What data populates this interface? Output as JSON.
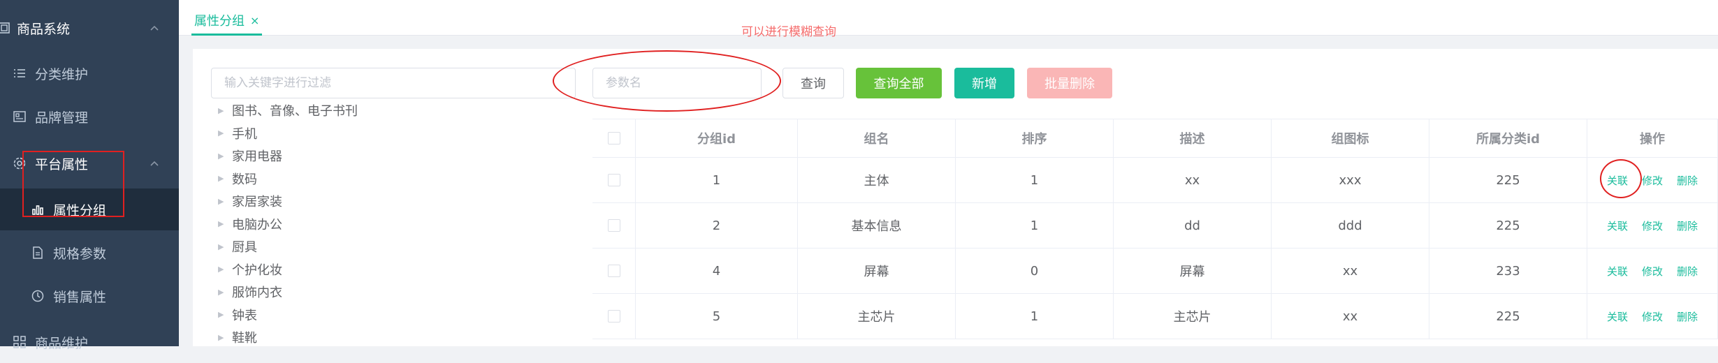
{
  "sidebar": {
    "items": [
      {
        "label": "商品系统",
        "icon": "grid-icon",
        "chevron": "^"
      },
      {
        "label": "分类维护",
        "icon": "list-icon"
      },
      {
        "label": "品牌管理",
        "icon": "picture-icon"
      },
      {
        "label": "平台属性",
        "icon": "gear-icon",
        "chevron": "^"
      },
      {
        "label": "属性分组",
        "icon": "bar-chart-icon"
      },
      {
        "label": "规格参数",
        "icon": "document-icon"
      },
      {
        "label": "销售属性",
        "icon": "clock-icon"
      },
      {
        "label": "商品维护",
        "icon": "apps-icon"
      }
    ]
  },
  "tabbar": {
    "active_tab": "属性分组",
    "close": "×"
  },
  "notice": "可以进行模糊查询",
  "filter": {
    "placeholder": "输入关键字进行过滤"
  },
  "tree": {
    "nodes": [
      "图书、音像、电子书刊",
      "手机",
      "家用电器",
      "数码",
      "家居家装",
      "电脑办公",
      "厨具",
      "个护化妆",
      "服饰内衣",
      "钟表",
      "鞋靴"
    ]
  },
  "search": {
    "placeholder": "参数名"
  },
  "toolbar": {
    "query_label": "查询",
    "query_all_label": "查询全部",
    "add_label": "新增",
    "batch_delete_label": "批量删除"
  },
  "table": {
    "headers": [
      "分组id",
      "组名",
      "排序",
      "描述",
      "组图标",
      "所属分类id",
      "操作"
    ],
    "rows": [
      {
        "id": "1",
        "name": "主体",
        "sort": "1",
        "desc": "xx",
        "icon": "xxx",
        "catelog_id": "225"
      },
      {
        "id": "2",
        "name": "基本信息",
        "sort": "1",
        "desc": "dd",
        "icon": "ddd",
        "catelog_id": "225"
      },
      {
        "id": "4",
        "name": "屏幕",
        "sort": "0",
        "desc": "屏幕",
        "icon": "xx",
        "catelog_id": "233"
      },
      {
        "id": "5",
        "name": "主芯片",
        "sort": "1",
        "desc": "主芯片",
        "icon": "xx",
        "catelog_id": "225"
      }
    ],
    "actions": {
      "relate": "关联",
      "edit": "修改",
      "delete": "删除"
    }
  },
  "colors": {
    "accent": "#1abc9c",
    "sidebar_bg": "#304156",
    "annotation": "#e02020"
  }
}
